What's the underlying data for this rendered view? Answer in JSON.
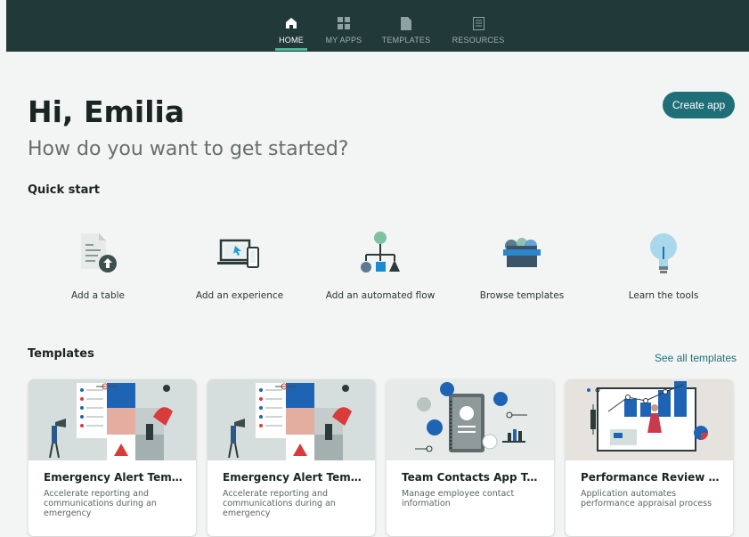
{
  "nav": {
    "items": [
      {
        "label": "HOME",
        "icon": "home-icon",
        "active": true
      },
      {
        "label": "MY APPS",
        "icon": "apps-grid-icon",
        "active": false
      },
      {
        "label": "TEMPLATES",
        "icon": "document-icon",
        "active": false
      },
      {
        "label": "RESOURCES",
        "icon": "book-icon",
        "active": false
      }
    ]
  },
  "header": {
    "greeting": "Hi, Emilia",
    "subtitle": "How do you want to get started?",
    "create_button": "Create app"
  },
  "quick_start": {
    "title": "Quick start",
    "items": [
      {
        "label": "Add a table",
        "icon": "add-table-icon"
      },
      {
        "label": "Add an experience",
        "icon": "devices-icon"
      },
      {
        "label": "Add an automated flow",
        "icon": "flow-icon"
      },
      {
        "label": "Browse templates",
        "icon": "templates-box-icon"
      },
      {
        "label": "Learn the tools",
        "icon": "lightbulb-icon"
      }
    ]
  },
  "templates": {
    "title": "Templates",
    "see_all": "See all templates",
    "cards": [
      {
        "title": "Emergency Alert Template",
        "description": "Accelerate reporting and communications during an emergency"
      },
      {
        "title": "Emergency Alert Template",
        "description": "Accelerate reporting and communications during an emergency"
      },
      {
        "title": "Team Contacts App Templ...",
        "description": "Manage employee contact information"
      },
      {
        "title": "Performance Review Tem...",
        "description": "Application automates performance appraisal process"
      }
    ]
  },
  "colors": {
    "nav_bg": "#22393a",
    "accent": "#1f6f79",
    "active_underline": "#4bb59a",
    "page_bg": "#f3f5f4"
  }
}
